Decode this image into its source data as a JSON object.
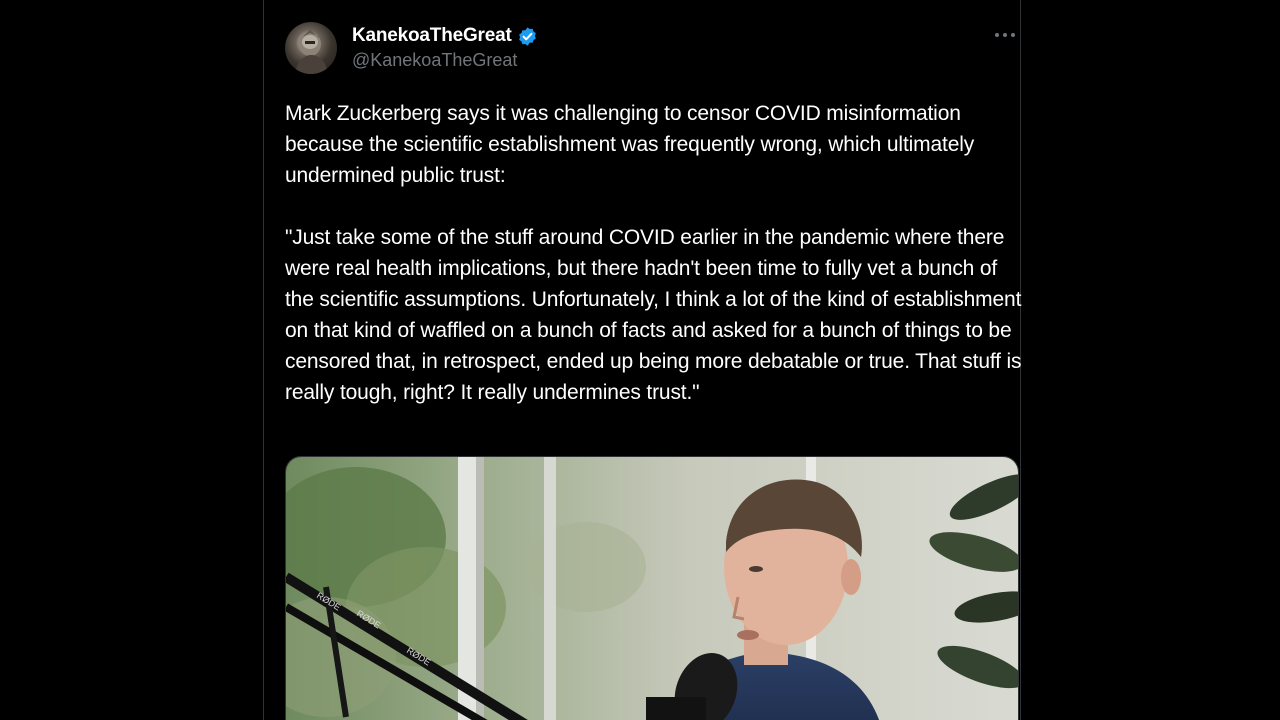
{
  "tweet": {
    "author": {
      "display_name": "KanekoaTheGreat",
      "handle": "@KanekoaTheGreat",
      "verified": true,
      "avatar_icon": "avatar-photo"
    },
    "more_icon": "more-horizontal-icon",
    "text_paragraphs": [
      "Mark Zuckerberg says it was challenging to censor COVID misinformation because the scientific establishment was frequently wrong, which ultimately undermined public trust:",
      "\"Just take some of the stuff around COVID earlier in the pandemic where there were real health implications, but there hadn't been time to fully vet a bunch of the scientific assumptions. Unfortunately, I think a lot of the kind of establishment on that kind of waffled on a bunch of facts and asked for a bunch of things to be censored that, in retrospect, ended up being more debatable or true. That stuff is really tough, right? It really undermines trust.\""
    ],
    "media": {
      "type": "video-still",
      "mic_brand": "RØDE"
    }
  },
  "colors": {
    "background": "#000000",
    "text": "#ffffff",
    "secondary_text": "#71767b",
    "verified_badge": "#1d9bf0",
    "border": "#2f3336"
  }
}
